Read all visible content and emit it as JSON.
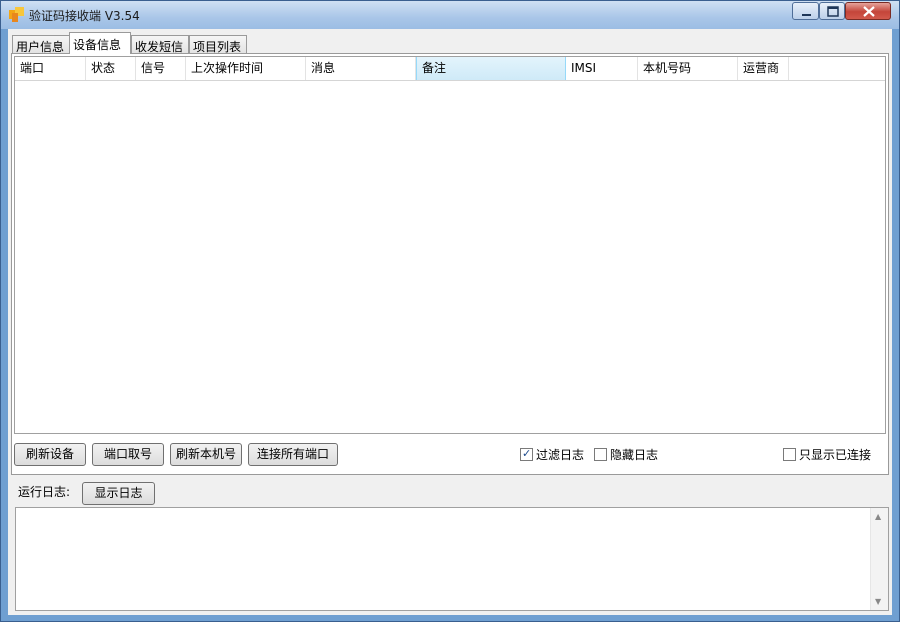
{
  "window": {
    "title": "验证码接收端 V3.54"
  },
  "tabs": [
    {
      "label": "用户信息",
      "active": false
    },
    {
      "label": "设备信息",
      "active": true
    },
    {
      "label": "收发短信",
      "active": false
    },
    {
      "label": "项目列表",
      "active": false
    }
  ],
  "device_table": {
    "columns": [
      "端口",
      "状态",
      "信号",
      "上次操作时间",
      "消息",
      "备注",
      "IMSI",
      "本机号码",
      "运营商"
    ],
    "sorted_column": "备注",
    "rows": []
  },
  "actions": {
    "refresh_devices": "刷新设备",
    "port_get_number": "端口取号",
    "refresh_local_number": "刷新本机号",
    "connect_all_ports": "连接所有端口"
  },
  "options": {
    "filter_log": {
      "label": "过滤日志",
      "checked": true
    },
    "hide_log": {
      "label": "隐藏日志",
      "checked": false
    },
    "only_connected": {
      "label": "只显示已连接",
      "checked": false
    }
  },
  "log": {
    "label": "运行日志:",
    "show_button": "显示日志",
    "content": ""
  },
  "colors": {
    "titlebar": "#a9c6e8",
    "window_frame": "#6f9fd1",
    "close_button": "#c4453a",
    "sorted_header": "#cfeaf8"
  }
}
